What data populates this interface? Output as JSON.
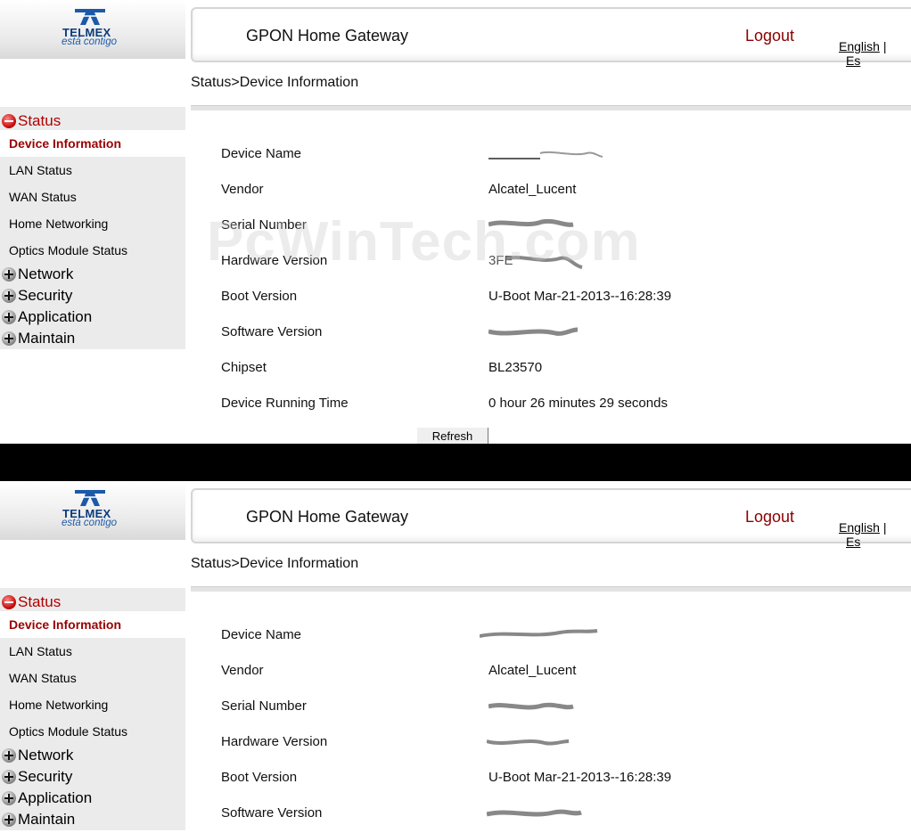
{
  "header": {
    "title": "GPON Home Gateway",
    "logout": "Logout",
    "lang_english": "English",
    "lang_sep": "|",
    "lang_other": "Es"
  },
  "logo": {
    "name": "TELMEX",
    "tagline": "está contigo"
  },
  "breadcrumb": "Status>Device Information",
  "sidebar": {
    "status": "Status",
    "items": [
      "Device Information",
      "LAN Status",
      "WAN Status",
      "Home Networking",
      "Optics Module Status"
    ],
    "network": "Network",
    "security": "Security",
    "application": "Application",
    "maintain": "Maintain"
  },
  "device_info": {
    "labels": [
      "Device Name",
      "Vendor",
      "Serial Number",
      "Hardware Version",
      "Boot Version",
      "Software Version",
      "Chipset",
      "Device Running Time"
    ],
    "vendor": "Alcatel_Lucent",
    "hardware_prefix": "3FE",
    "boot_version": "U-Boot Mar-21-2013--16:28:39",
    "chipset": "BL23570",
    "running_time": "0 hour 26 minutes 29 seconds"
  },
  "refresh_label": "Refresh",
  "watermark": "PcWinTech.com"
}
